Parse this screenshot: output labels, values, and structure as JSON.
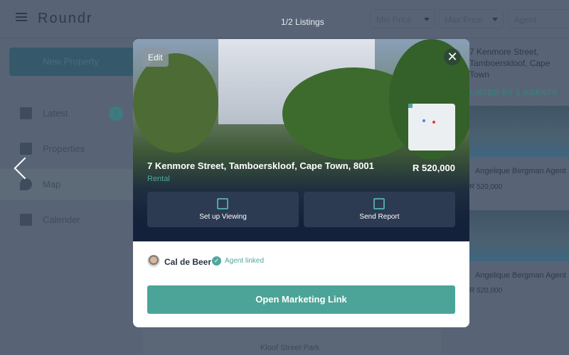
{
  "header": {
    "logo": "Roundr",
    "listing_count": "1/2 Listings",
    "filters": {
      "min_price": "Min Price",
      "max_price": "Max Price",
      "agent": "Agent"
    }
  },
  "sidebar": {
    "new_property": "New Property",
    "items": [
      {
        "label": "Latest",
        "badge": "2"
      },
      {
        "label": "Properties"
      },
      {
        "label": "Map"
      },
      {
        "label": "Calender"
      }
    ]
  },
  "right_panel": {
    "address": "7 Kenmore Street, Tamboerskloof, Cape Town",
    "section_label": "LISTED BY 2 AGENTS",
    "listings": [
      {
        "agent": "Angelique Bergman Agent",
        "price": "R 520,000"
      },
      {
        "agent": "Angelique Bergman Agent",
        "price": "R 520,000"
      }
    ]
  },
  "map": {
    "park_label": "Kloof Street Park"
  },
  "modal": {
    "edit_label": "Edit",
    "close_icon": "close-icon",
    "address": "7 Kenmore Street, Tamboerskloof, Cape Town, 8001",
    "price": "R 520,000",
    "type": "Rental",
    "actions": [
      {
        "label": "Set up Viewing",
        "icon": "calendar-icon"
      },
      {
        "label": "Send Report",
        "icon": "house-plus-icon"
      }
    ],
    "agent_name": "Cal de Beer",
    "agent_status": "Agent linked",
    "cta": "Open Marketing Link"
  },
  "colors": {
    "accent": "#4ba497",
    "modal_dark": "#14213a",
    "overlay": "#586476"
  }
}
